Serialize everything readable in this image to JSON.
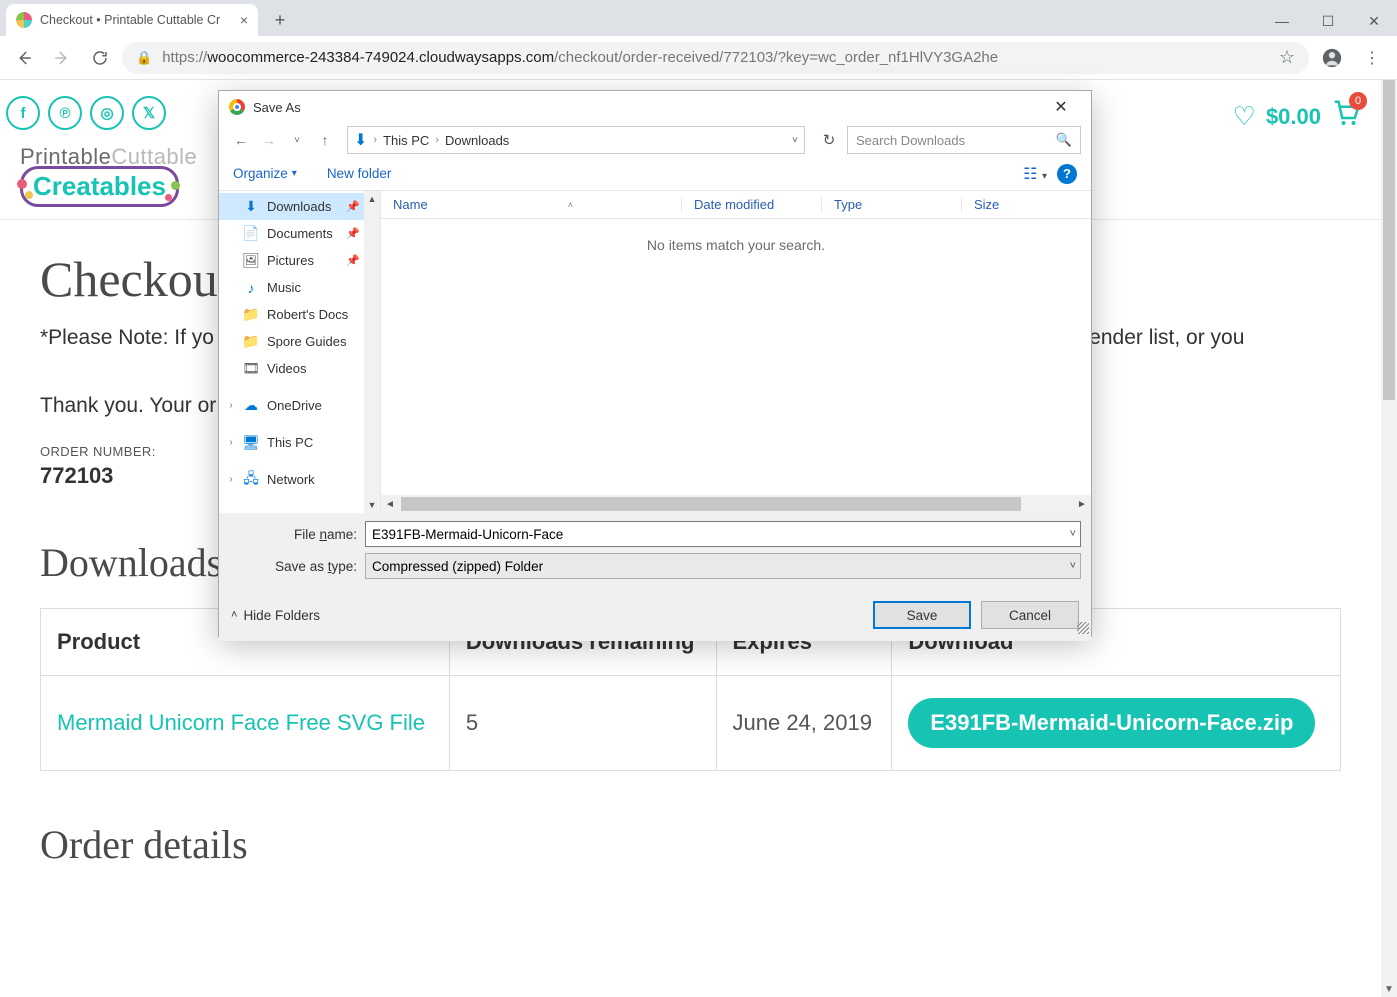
{
  "browser": {
    "tab_title": "Checkout • Printable Cuttable Cr",
    "url_host": "https://",
    "url_domain": "woocommerce-243384-749024.cloudwaysapps.com",
    "url_path": "/checkout/order-received/772103/?key=wc_order_nf1HlVY3GA2he"
  },
  "header": {
    "cart_price": "$0.00",
    "cart_badge": "0",
    "logo_line1a": "Printable",
    "logo_line1b": "Cuttable",
    "logo_badge": "Creatables"
  },
  "page": {
    "h1": "Checkout",
    "note_prefix": "*Please Note: If yo",
    "note_suffix": "ur approved sender list, or you",
    "thanks": "Thank you. Your or",
    "order_label": "ORDER NUMBER:",
    "order_value": "772103",
    "downloads_h": "Downloads",
    "order_details_h": "Order details",
    "table": {
      "headers": [
        "Product",
        "Downloads remaining",
        "Expires",
        "Download"
      ],
      "rows": [
        {
          "product": "Mermaid Unicorn Face Free SVG File",
          "remaining": "5",
          "expires": "June 24, 2019",
          "download": "E391FB-Mermaid-Unicorn-Face.zip"
        }
      ]
    }
  },
  "dialog": {
    "title": "Save As",
    "crumb1": "This PC",
    "crumb2": "Downloads",
    "search_placeholder": "Search Downloads",
    "organize": "Organize",
    "new_folder": "New folder",
    "columns": [
      "Name",
      "Date modified",
      "Type",
      "Size"
    ],
    "empty": "No items match your search.",
    "tree": [
      {
        "label": "Downloads",
        "icon": "⬇",
        "color": "#0078d4",
        "pinned": true,
        "selected": true
      },
      {
        "label": "Documents",
        "icon": "📄",
        "pinned": true
      },
      {
        "label": "Pictures",
        "icon": "🖼",
        "pinned": true
      },
      {
        "label": "Music",
        "icon": "♪",
        "color": "#0078d4"
      },
      {
        "label": "Robert's Docs",
        "icon": "📁",
        "color": "#f0c551"
      },
      {
        "label": "Spore Guides",
        "icon": "📁",
        "color": "#f0c551"
      },
      {
        "label": "Videos",
        "icon": "🎞"
      },
      {
        "label": "OneDrive",
        "icon": "☁",
        "color": "#0078d4",
        "expandable": true,
        "spaced": true
      },
      {
        "label": "This PC",
        "icon": "🖥",
        "color": "#0078d4",
        "expandable": true,
        "spaced": true
      },
      {
        "label": "Network",
        "icon": "🖧",
        "color": "#0078d4",
        "expandable": true,
        "spaced": true
      }
    ],
    "filename_label": "File name:",
    "filename_value": "E391FB-Mermaid-Unicorn-Face",
    "type_label": "Save as type:",
    "type_value": "Compressed (zipped) Folder",
    "hide_folders": "Hide Folders",
    "save": "Save",
    "cancel": "Cancel"
  }
}
